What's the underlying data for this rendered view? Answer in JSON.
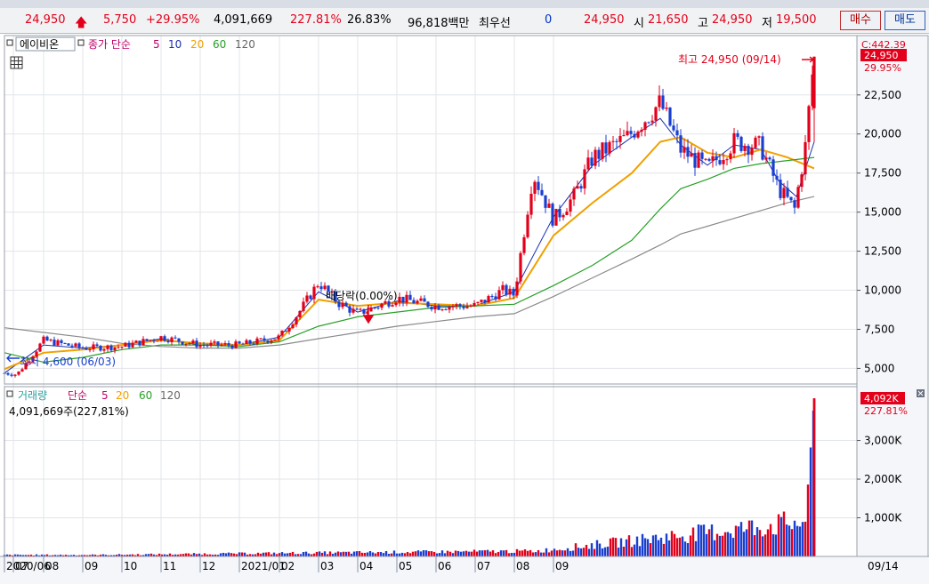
{
  "quote": {
    "price": "24,950",
    "change": "5,750",
    "change_pct": "+29.95%",
    "volume": "4,091,669",
    "volume_ratio": "227.81%",
    "turnover": "26.83%",
    "trade_value": "96,818백만",
    "best_quote_label": "최우선",
    "best_quote_qty": "0",
    "best_quote_price": "24,950",
    "open_label": "시",
    "open": "21,650",
    "high_label": "고",
    "high": "24,950",
    "low_label": "저",
    "low": "19,500",
    "buy_label": "매수",
    "sell_label": "매도"
  },
  "colors": {
    "up": "#e2001a",
    "down": "#1a3fd0",
    "ma5": "#1c2fb0",
    "ma20": "#f0a000",
    "ma60": "#28a028",
    "ma120": "#8a8a8a",
    "label_bg": "#e2001a"
  },
  "price_panel": {
    "title": "에이비온",
    "ma_label": "종가 단순",
    "ma_periods": [
      "5",
      "10",
      "20",
      "60",
      "120"
    ],
    "corner_label": "C:442.39",
    "last_price_tag": "24,950",
    "last_pct_tag": "29.95%",
    "high_annotation": "최고 24,950 (09/14)",
    "low_annotation": "최저 4,600 (06/03)",
    "dividend_annotation": "배당락(0.00%)"
  },
  "volume_panel": {
    "title": "거래량",
    "ma_label": "단순",
    "ma_periods": [
      "5",
      "20",
      "60",
      "120"
    ],
    "info": "4,091,669주(227,81%)",
    "last_tag": "4,092K",
    "last_pct_tag": "227.81%"
  },
  "chart_data": {
    "type": "candlestick",
    "price_axis": {
      "ticks": [
        5000,
        7500,
        10000,
        12500,
        15000,
        17500,
        20000,
        22500
      ],
      "labels": [
        "5,000",
        "7,500",
        "10,000",
        "12,500",
        "15,000",
        "17,500",
        "20,000",
        "22,500"
      ],
      "range": [
        4000,
        26300
      ]
    },
    "volume_axis": {
      "ticks": [
        1000,
        2000,
        3000
      ],
      "labels": [
        "1,000K",
        "2,000K",
        "3,000K"
      ],
      "range": [
        0,
        4300
      ]
    },
    "x_axis": {
      "labels": [
        "2020/06",
        "07",
        "08",
        "09",
        "10",
        "11",
        "12",
        "2021/01",
        "02",
        "03",
        "04",
        "05",
        "06",
        "07",
        "08",
        "09"
      ],
      "tick_days": [
        0,
        10,
        44,
        88,
        132,
        176,
        220,
        264,
        309,
        353,
        397,
        441,
        485,
        529,
        573,
        617
      ],
      "last_date": "09/14"
    },
    "series": [
      {
        "name": "종가",
        "points": [
          [
            0,
            4700
          ],
          [
            10,
            4650
          ],
          [
            14,
            4600
          ],
          [
            44,
            6800
          ],
          [
            88,
            6300
          ],
          [
            132,
            6400
          ],
          [
            176,
            7000
          ],
          [
            220,
            6500
          ],
          [
            264,
            6500
          ],
          [
            300,
            6900
          ],
          [
            309,
            7000
          ],
          [
            330,
            8500
          ],
          [
            353,
            10500
          ],
          [
            375,
            9200
          ],
          [
            397,
            8500
          ],
          [
            420,
            9000
          ],
          [
            441,
            9500
          ],
          [
            485,
            9000
          ],
          [
            529,
            9000
          ],
          [
            560,
            10000
          ],
          [
            573,
            9700
          ],
          [
            594,
            17500
          ],
          [
            617,
            14500
          ],
          [
            640,
            16000
          ],
          [
            661,
            18500
          ],
          [
            700,
            19800
          ],
          [
            737,
            22000
          ],
          [
            760,
            19000
          ],
          [
            790,
            17800
          ],
          [
            820,
            19500
          ],
          [
            850,
            19200
          ],
          [
            870,
            16500
          ],
          [
            888,
            15200
          ],
          [
            900,
            19200
          ],
          [
            910,
            24950
          ]
        ]
      },
      {
        "name": "5",
        "points": [
          [
            0,
            4700
          ],
          [
            44,
            6500
          ],
          [
            88,
            6300
          ],
          [
            132,
            6500
          ],
          [
            176,
            6900
          ],
          [
            220,
            6500
          ],
          [
            264,
            6500
          ],
          [
            309,
            7000
          ],
          [
            353,
            9900
          ],
          [
            397,
            8600
          ],
          [
            441,
            9300
          ],
          [
            485,
            9000
          ],
          [
            529,
            9000
          ],
          [
            573,
            9900
          ],
          [
            617,
            14700
          ],
          [
            661,
            18000
          ],
          [
            705,
            19800
          ],
          [
            737,
            21000
          ],
          [
            760,
            19300
          ],
          [
            790,
            18000
          ],
          [
            820,
            19300
          ],
          [
            850,
            19000
          ],
          [
            870,
            17000
          ],
          [
            890,
            16000
          ],
          [
            910,
            19500
          ]
        ]
      },
      {
        "name": "20",
        "points": [
          [
            0,
            4950
          ],
          [
            44,
            6000
          ],
          [
            88,
            6200
          ],
          [
            132,
            6500
          ],
          [
            176,
            6800
          ],
          [
            220,
            6600
          ],
          [
            264,
            6500
          ],
          [
            309,
            6800
          ],
          [
            353,
            9400
          ],
          [
            397,
            9000
          ],
          [
            441,
            9200
          ],
          [
            485,
            9100
          ],
          [
            529,
            9000
          ],
          [
            573,
            9500
          ],
          [
            617,
            13500
          ],
          [
            661,
            15600
          ],
          [
            705,
            17500
          ],
          [
            737,
            19500
          ],
          [
            760,
            19800
          ],
          [
            790,
            18800
          ],
          [
            820,
            18500
          ],
          [
            850,
            19000
          ],
          [
            880,
            18500
          ],
          [
            910,
            17800
          ]
        ]
      },
      {
        "name": "60",
        "points": [
          [
            0,
            6000
          ],
          [
            44,
            5400
          ],
          [
            88,
            5700
          ],
          [
            132,
            6200
          ],
          [
            176,
            6500
          ],
          [
            220,
            6500
          ],
          [
            264,
            6400
          ],
          [
            309,
            6700
          ],
          [
            353,
            7700
          ],
          [
            397,
            8300
          ],
          [
            441,
            8600
          ],
          [
            485,
            8900
          ],
          [
            529,
            9000
          ],
          [
            573,
            9100
          ],
          [
            617,
            10300
          ],
          [
            661,
            11600
          ],
          [
            705,
            13200
          ],
          [
            737,
            15200
          ],
          [
            760,
            16500
          ],
          [
            790,
            17100
          ],
          [
            820,
            17800
          ],
          [
            850,
            18100
          ],
          [
            880,
            18300
          ],
          [
            910,
            18500
          ]
        ]
      },
      {
        "name": "120",
        "points": [
          [
            0,
            7600
          ],
          [
            44,
            7300
          ],
          [
            88,
            7000
          ],
          [
            132,
            6600
          ],
          [
            176,
            6400
          ],
          [
            220,
            6300
          ],
          [
            264,
            6300
          ],
          [
            309,
            6500
          ],
          [
            353,
            6900
          ],
          [
            397,
            7300
          ],
          [
            441,
            7700
          ],
          [
            485,
            8000
          ],
          [
            529,
            8300
          ],
          [
            573,
            8500
          ],
          [
            617,
            9600
          ],
          [
            661,
            10800
          ],
          [
            705,
            12000
          ],
          [
            737,
            12900
          ],
          [
            760,
            13600
          ],
          [
            790,
            14100
          ],
          [
            820,
            14600
          ],
          [
            850,
            15100
          ],
          [
            880,
            15600
          ],
          [
            910,
            16000
          ]
        ]
      }
    ],
    "volume": {
      "name": "거래량",
      "points": [
        [
          0,
          40
        ],
        [
          100,
          40
        ],
        [
          330,
          90
        ],
        [
          600,
          140
        ],
        [
          900,
          900
        ],
        [
          905,
          2500
        ],
        [
          910,
          4092
        ]
      ]
    }
  }
}
